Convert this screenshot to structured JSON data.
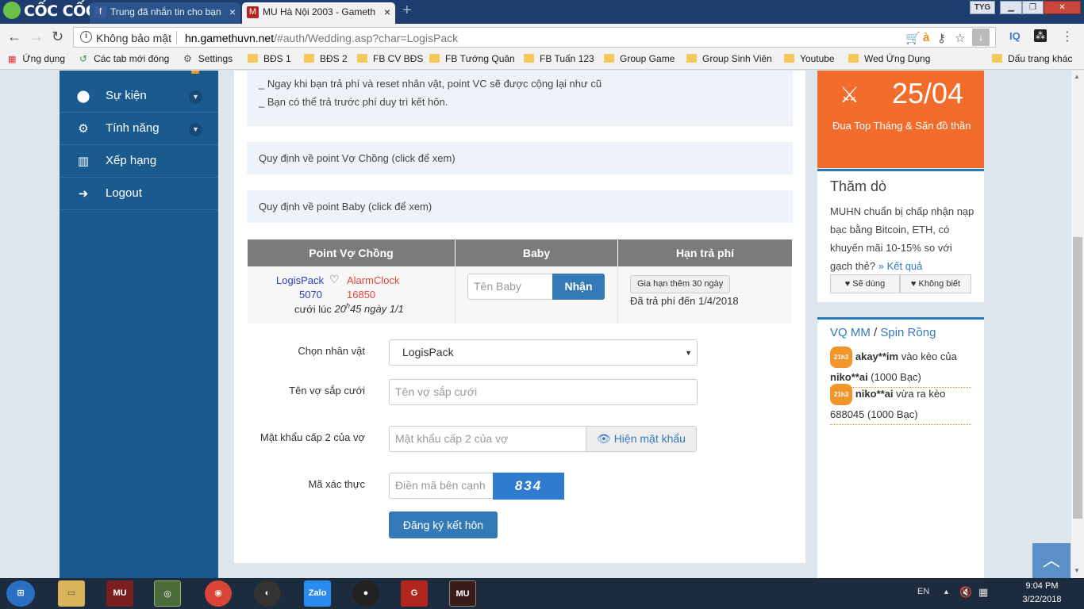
{
  "browser": {
    "logo_text": "CỐC CỐC",
    "tabs": [
      {
        "title": "Trung đã nhắn tin cho bạn",
        "favicon": "facebook-icon",
        "active": false
      },
      {
        "title": "MU Hà Nội 2003 - Gameth",
        "favicon": "mu-icon",
        "active": true
      }
    ],
    "profile_label": "TYG",
    "security_label": "Không bảo mật",
    "url_host": "hn.gamethuvn.net",
    "url_path": "/#auth/Wedding.asp?char=LogisPack",
    "bookmarks": [
      {
        "label": "Ứng dụng",
        "icon": "apps-grid-icon"
      },
      {
        "label": "Các tab mới đóng",
        "icon": "history-icon"
      },
      {
        "label": "Settings",
        "icon": "gear-icon"
      },
      {
        "label": "BĐS 1",
        "icon": "folder-icon"
      },
      {
        "label": "BĐS 2",
        "icon": "folder-icon"
      },
      {
        "label": "FB CV BĐS",
        "icon": "folder-icon"
      },
      {
        "label": "FB Tướng Quân",
        "icon": "folder-icon"
      },
      {
        "label": "FB Tuấn 123",
        "icon": "folder-icon"
      },
      {
        "label": "Group Game",
        "icon": "folder-icon"
      },
      {
        "label": "Group Sinh Viên",
        "icon": "folder-icon"
      },
      {
        "label": "Youtube",
        "icon": "folder-icon"
      },
      {
        "label": "Wed Ứng Dụng",
        "icon": "folder-icon"
      }
    ],
    "other_bookmarks": "Dấu trang khác"
  },
  "sidebar": {
    "items": [
      {
        "label": "Sự kiện",
        "icon": "android-icon",
        "has_chevron": true
      },
      {
        "label": "Tính năng",
        "icon": "gears-icon",
        "has_chevron": true
      },
      {
        "label": "Xếp hạng",
        "icon": "bar-chart-icon",
        "has_chevron": false
      },
      {
        "label": "Logout",
        "icon": "logout-icon",
        "has_chevron": false
      }
    ]
  },
  "notice": {
    "line1": "_ Ngay khi bạn trả phí và reset nhân vật, point VC sẽ được cộng lại như cũ",
    "line2": "_ Bạn có thể trả trước phí duy trì kết hôn."
  },
  "rules": {
    "spouse_points": "Quy định về point Vợ Chồng (click để xem)",
    "baby_points": "Quy định về point Baby (click để xem)"
  },
  "table": {
    "headers": [
      "Point Vợ Chồng",
      "Baby",
      "Hạn trả phí"
    ],
    "husband_name": "LogisPack",
    "husband_points": "5070",
    "wife_name": "AlarmClock",
    "wife_points": "16850",
    "married_prefix": "cưới lúc ",
    "married_hour": "20",
    "married_sup": "h",
    "married_rest": "45 ngày 1/1",
    "baby_placeholder": "Tên Baby",
    "baby_button": "Nhận",
    "extend_button": "Gia hạn thêm 30 ngày",
    "paid_until": "Đã trả phí đến 1/4/2018"
  },
  "form": {
    "character_label": "Chọn nhân vật",
    "character_value": "LogisPack",
    "spouse_label": "Tên vợ sắp cưới",
    "spouse_placeholder": "Tên vợ sắp cưới",
    "password_label": "Mật khẩu cấp 2 của vợ",
    "password_placeholder": "Mật khẩu cấp 2 của vợ",
    "show_password": "Hiện mật khẩu",
    "captcha_label": "Mã xác thực",
    "captcha_placeholder": "Điền mã bên cạnh",
    "captcha_text": "834",
    "submit": "Đăng ký kết hôn"
  },
  "promo": {
    "date": "25/04",
    "text": "Đua Top Tháng & Săn đồ thần"
  },
  "poll": {
    "title": "Thăm dò",
    "question": "MUHN chuẩn bị chấp nhận nạp bạc bằng Bitcoin, ETH, có khuyến mãi 10-15% so với gạch thẻ?",
    "result_link": "» Kết quả",
    "option1": "Sẽ dùng",
    "option2": "Không biết"
  },
  "vq": {
    "title1": "VQ MM",
    "divider": " / ",
    "title2": "Spin Rồng",
    "entries": [
      {
        "time": "21h3",
        "user": "akay**im",
        "action": " vào kèo của ",
        "target": "niko**ai",
        "amount": " (1000 Bạc)"
      },
      {
        "time": "21h3",
        "user": "niko**ai",
        "action": " vừa ra kèo ",
        "target": "688045",
        "amount": " (1000 Bạc)"
      }
    ]
  },
  "taskbar": {
    "language": "EN",
    "time": "9:04 PM",
    "date": "3/22/2018"
  }
}
